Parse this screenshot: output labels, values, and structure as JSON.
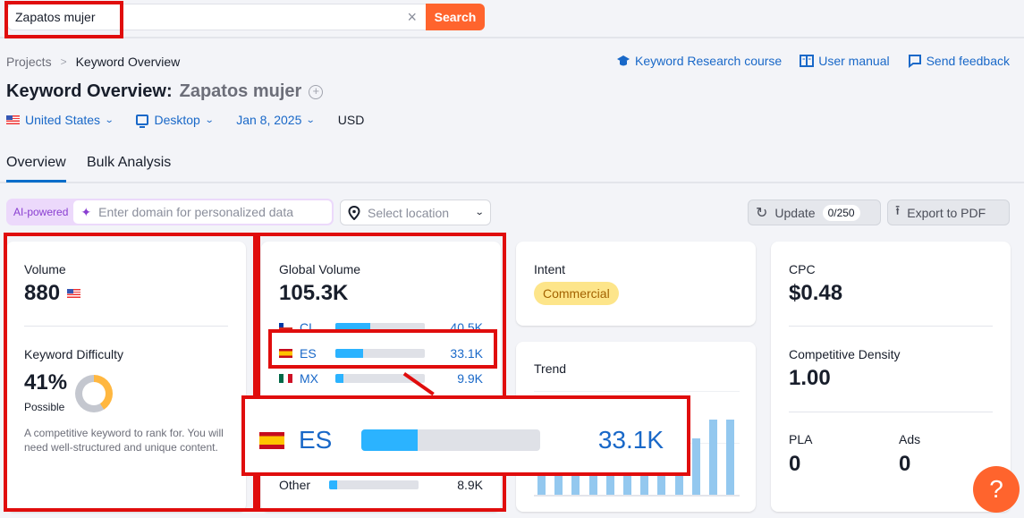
{
  "search": {
    "value": "Zapatos mujer",
    "button_label": "Search",
    "clear_icon": "close-icon"
  },
  "breadcrumb": {
    "items": [
      "Projects",
      "Keyword Overview"
    ],
    "separator": ">"
  },
  "help_links": [
    {
      "label": "Keyword Research course",
      "icon": "graduation-cap-icon"
    },
    {
      "label": "User manual",
      "icon": "book-icon"
    },
    {
      "label": "Send feedback",
      "icon": "message-icon"
    }
  ],
  "header": {
    "title_prefix": "Keyword Overview:",
    "keyword": "Zapatos mujer",
    "add_icon": "+"
  },
  "filters": {
    "country": "United States",
    "device": "Desktop",
    "date": "Jan 8, 2025",
    "currency": "USD"
  },
  "tabs": [
    {
      "label": "Overview",
      "active": true
    },
    {
      "label": "Bulk Analysis",
      "active": false
    }
  ],
  "toolbar": {
    "ai_label": "AI-powered",
    "domain_placeholder": "Enter domain for personalized data",
    "location_placeholder": "Select location",
    "update_label": "Update",
    "update_counter": "0/250",
    "export_label": "Export to PDF"
  },
  "volume_card": {
    "volume_label": "Volume",
    "volume_value": "880",
    "kd_label": "Keyword Difficulty",
    "kd_value": "41%",
    "kd_percent": 41,
    "kd_level": "Possible",
    "kd_description": "A competitive keyword to rank for. You will need well-structured and unique content."
  },
  "global_volume_card": {
    "label": "Global Volume",
    "value": "105.3K",
    "countries": [
      {
        "code": "CL",
        "value": "40.5K",
        "share": 0.385
      },
      {
        "code": "ES",
        "value": "33.1K",
        "share": 0.314
      },
      {
        "code": "MX",
        "value": "9.9K",
        "share": 0.094
      }
    ],
    "other": {
      "label": "Other",
      "value": "8.9K",
      "share": 0.085
    }
  },
  "intent_card": {
    "label": "Intent",
    "badge": "Commercial"
  },
  "trend_card": {
    "label": "Trend",
    "bars": [
      0.95,
      0.55,
      0.55,
      0.55,
      0.55,
      0.55,
      0.55,
      0.55,
      0.55,
      0.55,
      0.74,
      0.74
    ]
  },
  "cpc_card": {
    "cpc_label": "CPC",
    "cpc_value": "$0.48",
    "density_label": "Competitive Density",
    "density_value": "1.00",
    "pla_label": "PLA",
    "pla_value": "0",
    "ads_label": "Ads",
    "ads_value": "0"
  },
  "magnifier": {
    "code": "ES",
    "value": "33.1K",
    "share": 0.314
  },
  "help_button": "?",
  "colors": {
    "accent": "#ff642d",
    "link": "#1968c8",
    "bar": "#2bb3ff",
    "highlight": "#e00d0d",
    "intent_badge": "#fde58a"
  }
}
